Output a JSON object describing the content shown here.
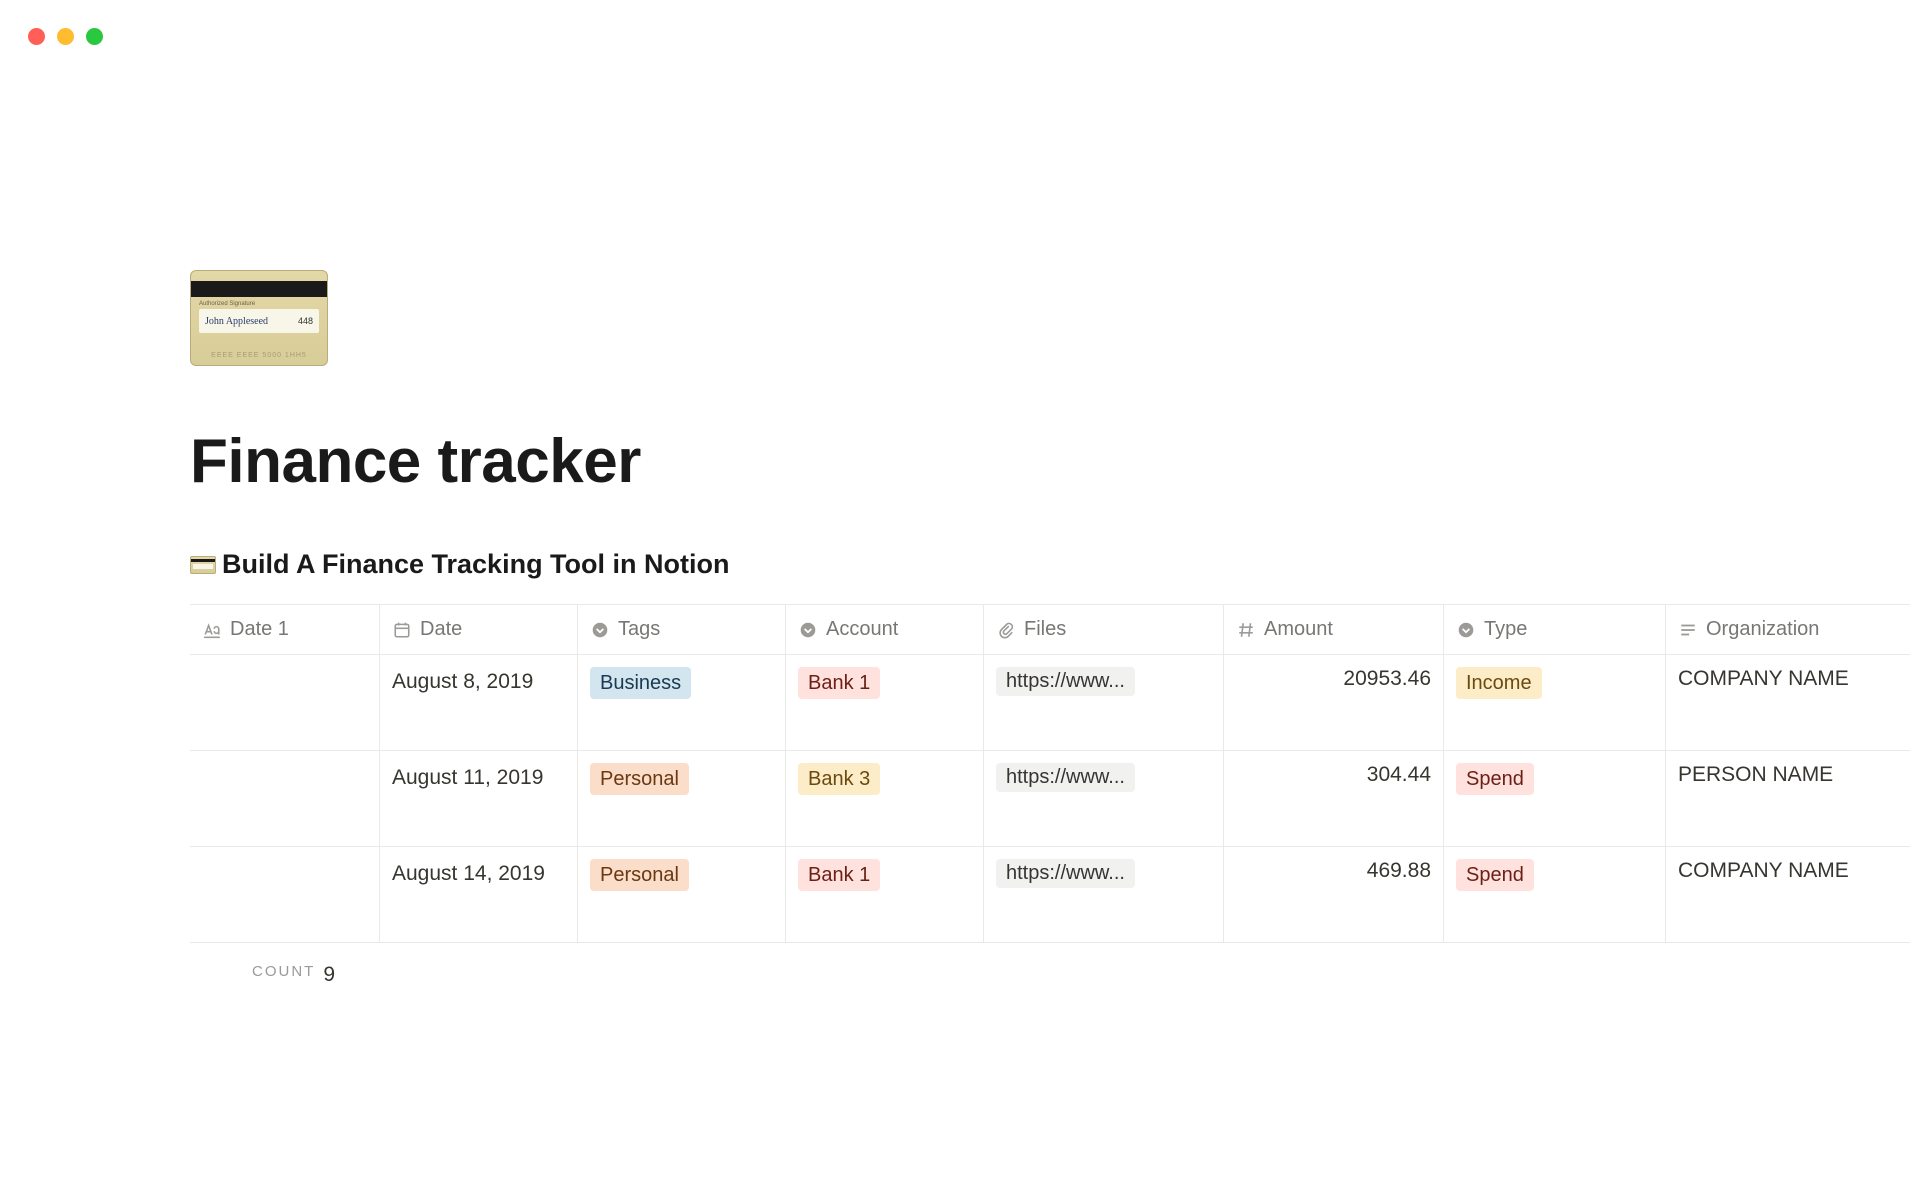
{
  "page": {
    "title": "Finance tracker",
    "icon_signature": "John Appleseed",
    "icon_sig_num": "448",
    "icon_auth_label": "Authorized Signature",
    "icon_emboss": "EEEE  EEEE  5000  1HH5",
    "subpage_title": "Build A Finance Tracking Tool in Notion"
  },
  "columns": {
    "date1": "Date 1",
    "date": "Date",
    "tags": "Tags",
    "account": "Account",
    "files": "Files",
    "amount": "Amount",
    "type": "Type",
    "organization": "Organization"
  },
  "rows": [
    {
      "date": "August 8, 2019",
      "tag": "Business",
      "tag_class": "tag-business",
      "account": "Bank 1",
      "account_class": "tag-bank1",
      "file": "https://www...",
      "amount": "20953.46",
      "type": "Income",
      "type_class": "tag-income",
      "org": "COMPANY NAME"
    },
    {
      "date": "August 11, 2019",
      "tag": "Personal",
      "tag_class": "tag-personal",
      "account": "Bank 3",
      "account_class": "tag-bank3",
      "file": "https://www...",
      "amount": "304.44",
      "type": "Spend",
      "type_class": "tag-spend",
      "org": "PERSON NAME"
    },
    {
      "date": "August 14, 2019",
      "tag": "Personal",
      "tag_class": "tag-personal",
      "account": "Bank 1",
      "account_class": "tag-bank1",
      "file": "https://www...",
      "amount": "469.88",
      "type": "Spend",
      "type_class": "tag-spend",
      "org": "COMPANY NAME"
    }
  ],
  "footer": {
    "count_label": "COUNT",
    "count_value": "9"
  }
}
